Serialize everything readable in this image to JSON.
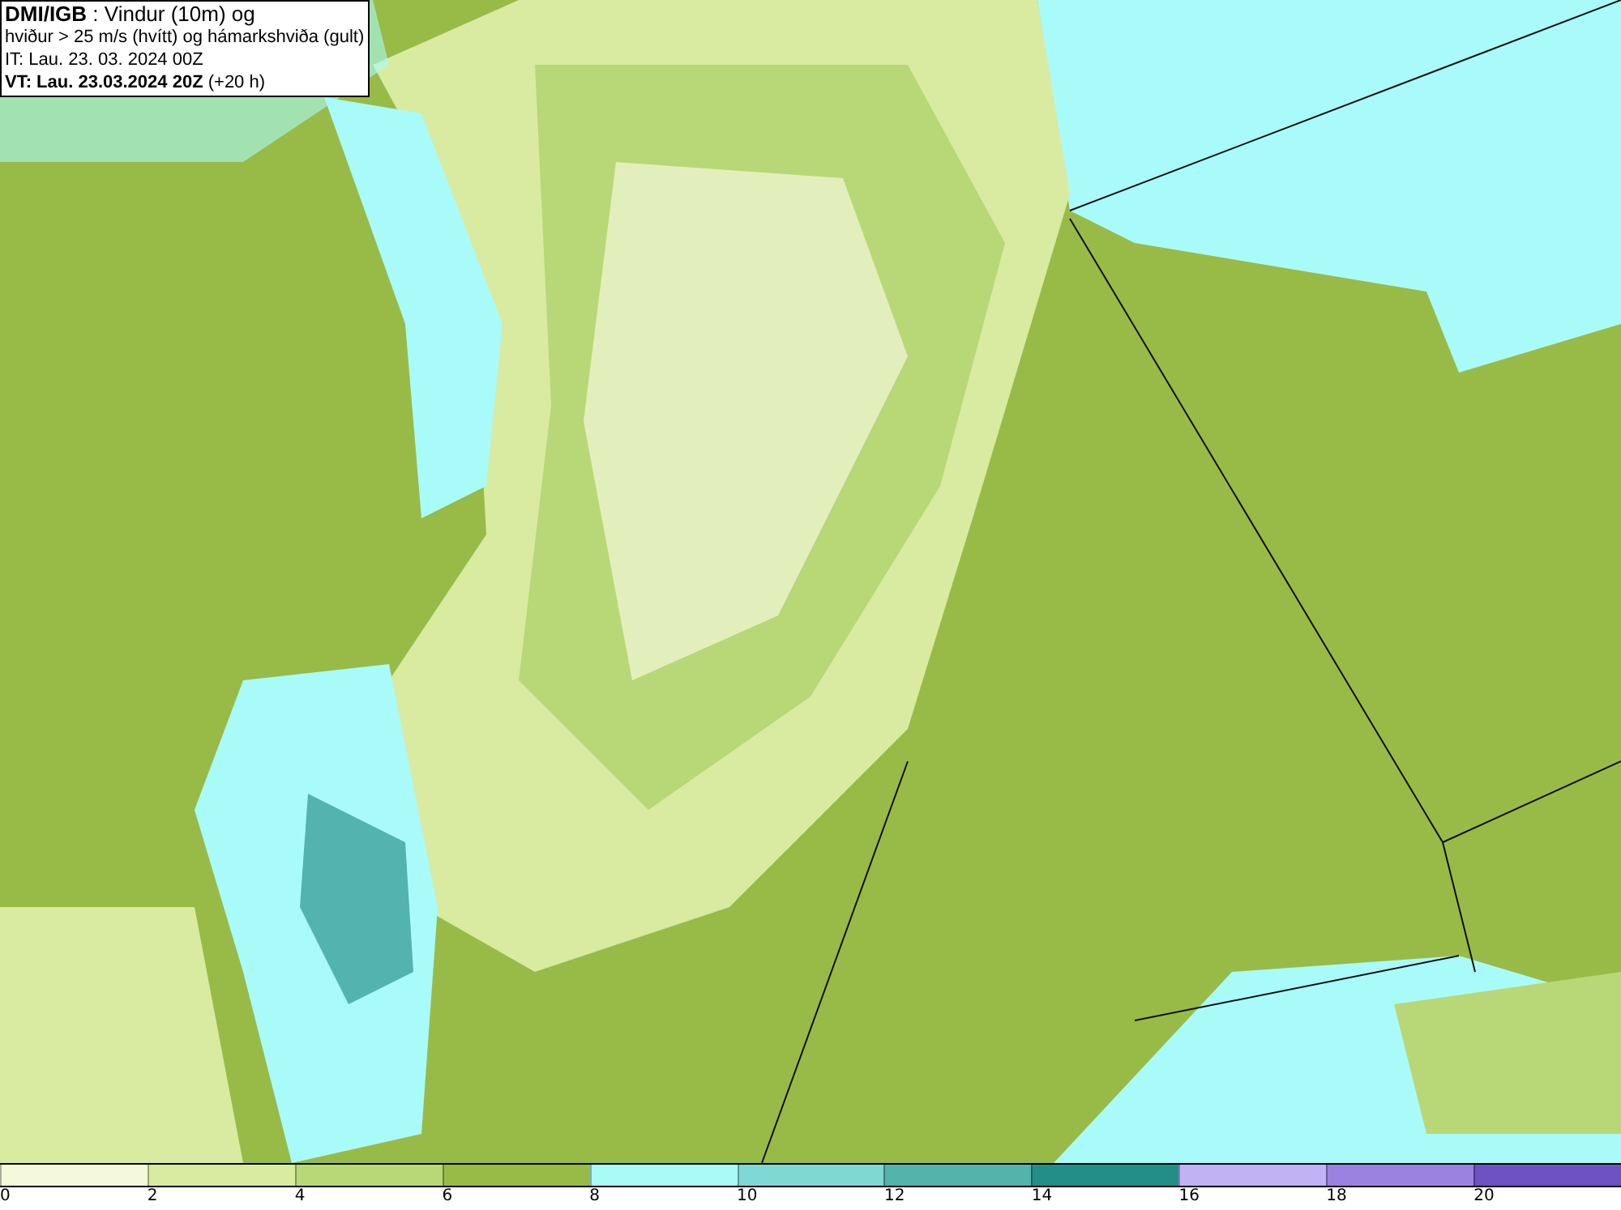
{
  "info_box": {
    "lines": [
      "**DMI/IGB** : Vindur (10m) og",
      "hviður > 25 m/s (hvítt) og hámarkshviða (gult)",
      "IT: Lau. 23. 03. 2024 00Z",
      "**VT: Lau. 23.03.2024 20Z** (+20 h)"
    ]
  },
  "colorbar": {
    "segments": [
      {
        "color": "#f4f9dc"
      },
      {
        "color": "#d8eba0"
      },
      {
        "color": "#b8d877"
      },
      {
        "color": "#98bb48"
      },
      {
        "color": "#a9fbf9"
      },
      {
        "color": "#7fd8d3"
      },
      {
        "color": "#53b3ad"
      },
      {
        "color": "#238e88"
      },
      {
        "color": "#c0b2f5"
      },
      {
        "color": "#9a82e0"
      },
      {
        "color": "#6c52c2"
      }
    ],
    "labels": [
      "0",
      "2",
      "4",
      "6",
      "8",
      "10",
      "12",
      "14",
      "16",
      "18",
      "20"
    ]
  }
}
